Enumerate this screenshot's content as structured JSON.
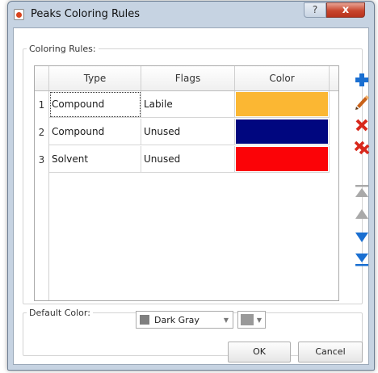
{
  "window": {
    "title": "Peaks Coloring Rules",
    "help_glyph": "?",
    "close_glyph": "x"
  },
  "rules": {
    "group_label": "Coloring Rules:",
    "columns": [
      "Type",
      "Flags",
      "Color"
    ],
    "rows": [
      {
        "num": "1",
        "type": "Compound",
        "flags": "Labile",
        "color": "#fbb733",
        "selected": true
      },
      {
        "num": "2",
        "type": "Compound",
        "flags": "Unused",
        "color": "#00067f",
        "selected": false
      },
      {
        "num": "3",
        "type": "Solvent",
        "flags": "Unused",
        "color": "#fb0307",
        "selected": false
      }
    ]
  },
  "toolbar": [
    {
      "name": "add-icon",
      "enabled": true
    },
    {
      "name": "edit-icon",
      "enabled": true
    },
    {
      "name": "delete-icon",
      "enabled": true
    },
    {
      "name": "delete-all-icon",
      "enabled": true
    },
    {
      "name": "move-top-icon",
      "enabled": false
    },
    {
      "name": "move-up-icon",
      "enabled": false
    },
    {
      "name": "move-down-icon",
      "enabled": true
    },
    {
      "name": "move-bottom-icon",
      "enabled": true
    }
  ],
  "default_color": {
    "group_label": "Default Color:",
    "selected": "Dark Gray",
    "swatch_color": "#7f7f7f",
    "picker_color": "#999999"
  },
  "buttons": {
    "ok": "OK",
    "cancel": "Cancel"
  },
  "colors": {
    "accent_blue": "#1a6fd1",
    "delete_red": "#d8281c",
    "edit_orange": "#c8621a"
  }
}
